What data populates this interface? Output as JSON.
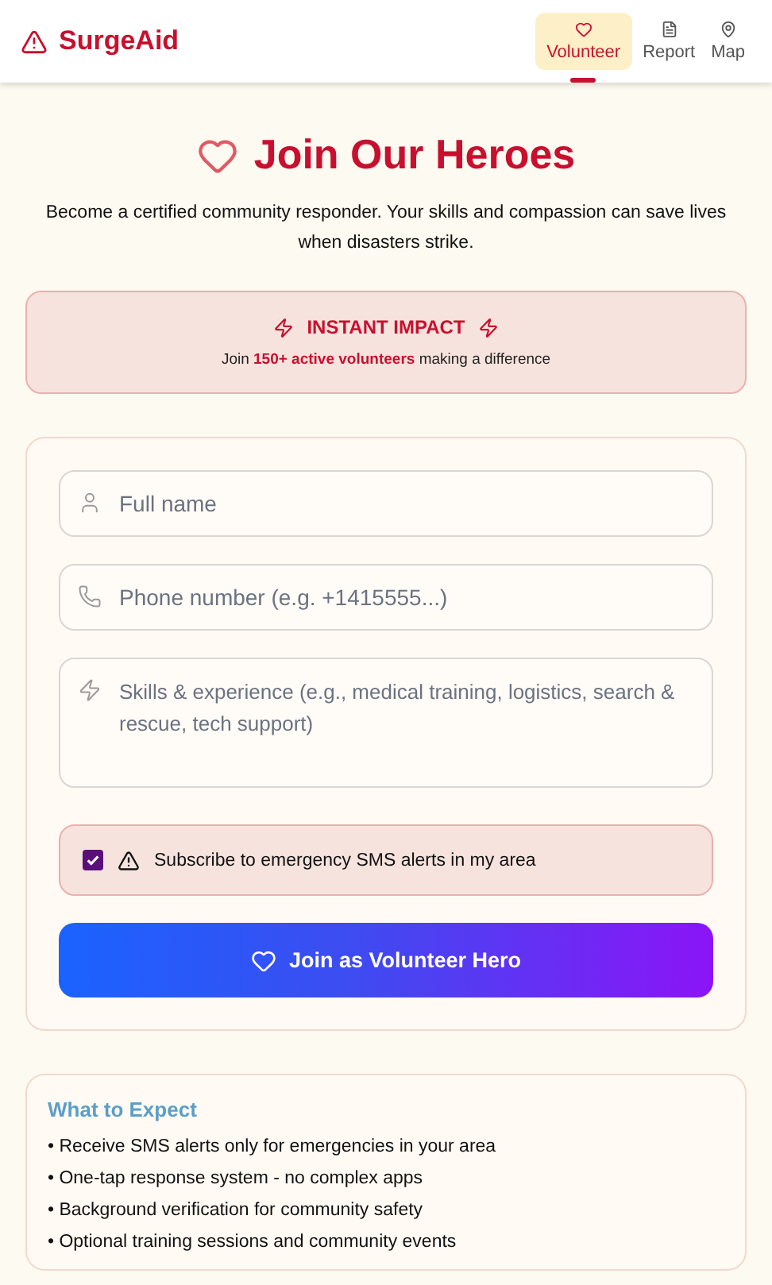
{
  "header": {
    "brand": "SurgeAid",
    "nav": [
      {
        "label": "Volunteer",
        "selected": true
      },
      {
        "label": "Report",
        "selected": false
      },
      {
        "label": "Map",
        "selected": false
      }
    ]
  },
  "hero": {
    "title": "Join Our Heroes",
    "subtitle": "Become a certified community responder. Your skills and compassion can save lives when disasters strike."
  },
  "impact": {
    "title": "INSTANT IMPACT",
    "text": "Join **150+ active volunteers** making a difference"
  },
  "form": {
    "fields": [
      {
        "kind": "input",
        "placeholder": "Full name"
      },
      {
        "kind": "input",
        "placeholder": "Phone number (e.g. +1415555...)"
      },
      {
        "kind": "textarea",
        "placeholder": "Skills & experience (e.g., medical training, logistics, search & rescue, tech support)"
      }
    ],
    "sms": {
      "label": "Subscribe to emergency SMS alerts in my area",
      "checked": true
    },
    "submit": "Join as Volunteer Hero"
  },
  "expect": {
    "title": "What to Expect",
    "items": [
      "• Receive SMS alerts only for emergencies in your area",
      "• One-tap response system - no complex apps",
      "• Background verification for community safety",
      "• Optional training sessions and community events"
    ]
  }
}
